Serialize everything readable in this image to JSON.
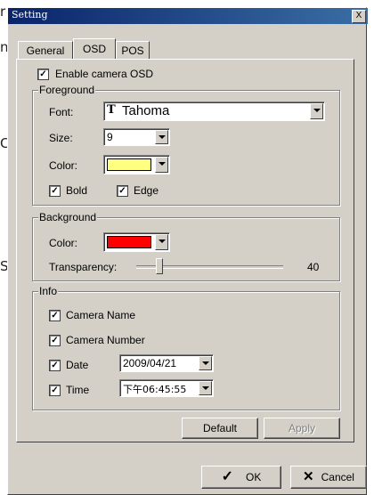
{
  "background": {
    "fragments": [
      "r",
      "n",
      "C",
      "S"
    ]
  },
  "window": {
    "title": "Setting",
    "close_glyph": "X"
  },
  "tabs": [
    {
      "label": "General",
      "active": false
    },
    {
      "label": "OSD",
      "active": true
    },
    {
      "label": "POS",
      "active": false
    }
  ],
  "osd": {
    "enable_label": "Enable camera OSD",
    "enable_checked": true,
    "foreground": {
      "title": "Foreground",
      "font_label": "Font:",
      "font_value": "Tahoma",
      "font_icon": "truetype-icon",
      "size_label": "Size:",
      "size_value": "9",
      "color_label": "Color:",
      "color_value": "#ffff80",
      "bold_label": "Bold",
      "bold_checked": true,
      "edge_label": "Edge",
      "edge_checked": true
    },
    "background": {
      "title": "Background",
      "color_label": "Color:",
      "color_value": "#ff0000",
      "transparency_label": "Transparency:",
      "transparency_value": "40",
      "transparency_fraction": 0.16
    },
    "info": {
      "title": "Info",
      "camera_name_label": "Camera Name",
      "camera_name_checked": true,
      "camera_number_label": "Camera Number",
      "camera_number_checked": true,
      "date_label": "Date",
      "date_checked": true,
      "date_value": "2009/04/21",
      "time_label": "Time",
      "time_checked": true,
      "time_value": "下午06:45:55"
    },
    "default_label": "Default",
    "apply_label": "Apply"
  },
  "footer": {
    "ok_label": "OK",
    "cancel_label": "Cancel"
  },
  "check_glyph": "✓",
  "colors": {
    "titlebar_start": "#0a246a",
    "titlebar_end": "#3a6ea5",
    "dialog_bg": "#d4d0c8"
  }
}
